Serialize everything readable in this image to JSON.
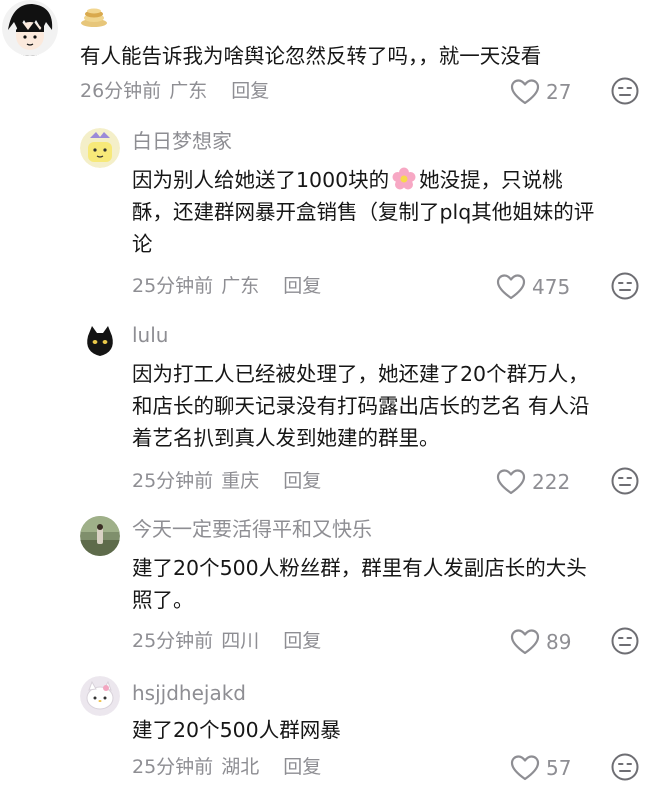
{
  "comments": [
    {
      "username": "",
      "text_lines": [
        "有人能告诉我为啥舆论忽然反转了吗，，就一天没看"
      ],
      "time": "26分钟前",
      "location": "广东",
      "reply_label": "回复",
      "likes": "27"
    },
    {
      "username": "白日梦想家",
      "text_lines": [
        "因为别人给她送了1000块的",
        "她没提，只说桃",
        "酥，还建群网暴开盒销售（复制了plq其他姐妹的评",
        "论"
      ],
      "time": "25分钟前",
      "location": "广东",
      "reply_label": "回复",
      "likes": "475"
    },
    {
      "username": "lulu",
      "text_lines": [
        "因为打工人已经被处理了，她还建了20个群万人，",
        "和店长的聊天记录没有打码露出店长的艺名 有人沿",
        "着艺名扒到真人发到她建的群里。"
      ],
      "time": "25分钟前",
      "location": "重庆",
      "reply_label": "回复",
      "likes": "222"
    },
    {
      "username": "今天一定要活得平和又快乐",
      "text_lines": [
        "建了20个500人粉丝群，群里有人发副店长的大头",
        "照了。"
      ],
      "time": "25分钟前",
      "location": "四川",
      "reply_label": "回复",
      "likes": "89"
    },
    {
      "username": "hsjjdhejakd",
      "text_lines": [
        "建了20个500人群网暴"
      ],
      "time": "25分钟前",
      "location": "湖北",
      "reply_label": "回复",
      "likes": "57"
    }
  ],
  "icons": {
    "like": "heart-outline-icon",
    "dislike": "unhappy-face-icon",
    "flower": "flower-emoji"
  },
  "colors": {
    "text": "#161616",
    "meta": "#8e8e93"
  }
}
